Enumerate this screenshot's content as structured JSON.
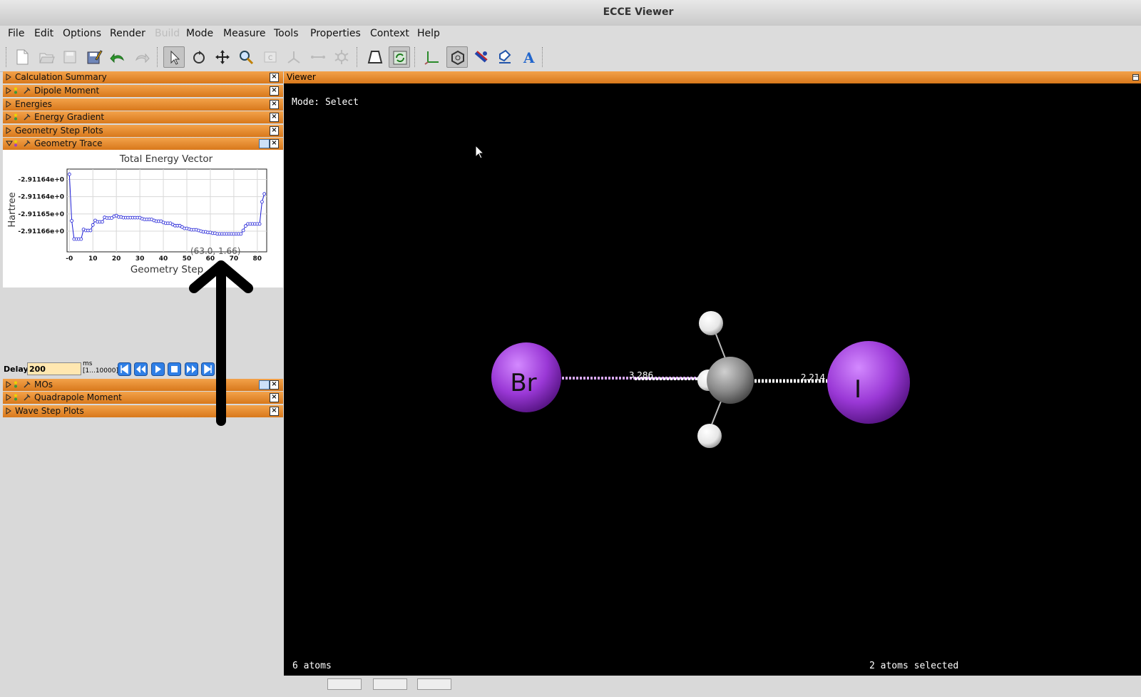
{
  "window": {
    "title": "ECCE Viewer"
  },
  "menu": [
    {
      "label": "File"
    },
    {
      "label": "Edit"
    },
    {
      "label": "Options"
    },
    {
      "label": "Render"
    },
    {
      "label": "Build",
      "disabled": true
    },
    {
      "label": "Mode"
    },
    {
      "label": "Measure"
    },
    {
      "label": "Tools"
    },
    {
      "label": "Properties"
    },
    {
      "label": "Context"
    },
    {
      "label": "Help"
    }
  ],
  "toolbar": {
    "icons": [
      "new-file-icon",
      "open-icon",
      "save-icon",
      "save-as-icon",
      "undo-icon",
      "redo-icon",
      "select-icon",
      "rotate-icon",
      "translate-icon",
      "zoom-icon",
      "center-icon",
      "angle-icon",
      "bond-icon",
      "atom-icon",
      "perspective-icon",
      "sync-icon",
      "axes-icon",
      "hexagon-icon",
      "color-icon",
      "label-style-icon",
      "text-label-icon"
    ]
  },
  "panels": [
    {
      "label": "Calculation Summary"
    },
    {
      "label": "Dipole Moment"
    },
    {
      "label": "Energies"
    },
    {
      "label": "Energy Gradient"
    },
    {
      "label": "Geometry Step Plots"
    },
    {
      "label": "Geometry Trace"
    },
    {
      "label": "MOs"
    },
    {
      "label": "Quadrapole Moment"
    },
    {
      "label": "Wave Step Plots"
    }
  ],
  "chart_data": {
    "type": "line",
    "title": "Total Energy Vector",
    "xlabel": "Geometry Step",
    "ylabel": "Hartree",
    "xlim": [
      -1,
      84
    ],
    "ylim": [
      -2.911665,
      -2.911641
    ],
    "x_ticks": [
      "-0",
      "10",
      "20",
      "30",
      "40",
      "50",
      "60",
      "70",
      "80"
    ],
    "y_ticks": [
      "-2.91164e+0",
      "-2.91164e+0",
      "-2.91165e+0",
      "-2.91166e+0"
    ],
    "y_tick_values": [
      -2.911644,
      -2.911649,
      -2.911654,
      -2.911659
    ],
    "overlay_text": "(63.0, 1.66)",
    "series": [
      {
        "values": [
          [
            0,
            -2.9116425
          ],
          [
            1,
            -2.911656
          ],
          [
            2,
            -2.9116613
          ],
          [
            3,
            -2.9116613
          ],
          [
            4,
            -2.9116613
          ],
          [
            5,
            -2.9116613
          ],
          [
            6,
            -2.9116585
          ],
          [
            7,
            -2.9116588
          ],
          [
            8,
            -2.9116588
          ],
          [
            9,
            -2.9116588
          ],
          [
            10,
            -2.9116572
          ],
          [
            11,
            -2.9116559
          ],
          [
            12,
            -2.9116563
          ],
          [
            13,
            -2.9116563
          ],
          [
            14,
            -2.9116563
          ],
          [
            15,
            -2.911655
          ],
          [
            16,
            -2.9116552
          ],
          [
            17,
            -2.9116552
          ],
          [
            18,
            -2.9116552
          ],
          [
            19,
            -2.9116547
          ],
          [
            20,
            -2.9116545
          ],
          [
            21,
            -2.9116549
          ],
          [
            22,
            -2.9116549
          ],
          [
            23,
            -2.9116551
          ],
          [
            24,
            -2.9116551
          ],
          [
            25,
            -2.9116551
          ],
          [
            26,
            -2.9116551
          ],
          [
            27,
            -2.9116551
          ],
          [
            28,
            -2.9116551
          ],
          [
            29,
            -2.9116551
          ],
          [
            30,
            -2.9116551
          ],
          [
            31,
            -2.9116554
          ],
          [
            32,
            -2.9116556
          ],
          [
            33,
            -2.9116556
          ],
          [
            34,
            -2.9116556
          ],
          [
            35,
            -2.9116556
          ],
          [
            36,
            -2.9116559
          ],
          [
            37,
            -2.9116561
          ],
          [
            38,
            -2.9116561
          ],
          [
            39,
            -2.9116561
          ],
          [
            40,
            -2.9116565
          ],
          [
            41,
            -2.9116567
          ],
          [
            42,
            -2.9116567
          ],
          [
            43,
            -2.9116567
          ],
          [
            44,
            -2.9116571
          ],
          [
            45,
            -2.9116574
          ],
          [
            46,
            -2.9116574
          ],
          [
            47,
            -2.9116574
          ],
          [
            48,
            -2.9116578
          ],
          [
            49,
            -2.9116582
          ],
          [
            50,
            -2.9116582
          ],
          [
            51,
            -2.9116584
          ],
          [
            52,
            -2.9116586
          ],
          [
            53,
            -2.9116586
          ],
          [
            54,
            -2.9116586
          ],
          [
            55,
            -2.9116588
          ],
          [
            56,
            -2.911659
          ],
          [
            57,
            -2.9116592
          ],
          [
            58,
            -2.9116592
          ],
          [
            59,
            -2.9116594
          ],
          [
            60,
            -2.9116594
          ],
          [
            61,
            -2.9116596
          ],
          [
            62,
            -2.9116596
          ],
          [
            63,
            -2.9116598
          ],
          [
            64,
            -2.9116598
          ],
          [
            65,
            -2.9116598
          ],
          [
            66,
            -2.9116598
          ],
          [
            67,
            -2.9116598
          ],
          [
            68,
            -2.9116598
          ],
          [
            69,
            -2.9116598
          ],
          [
            70,
            -2.9116598
          ],
          [
            71,
            -2.9116598
          ],
          [
            72,
            -2.9116598
          ],
          [
            73,
            -2.9116598
          ],
          [
            74,
            -2.9116588
          ],
          [
            75,
            -2.9116575
          ],
          [
            76,
            -2.9116569
          ],
          [
            77,
            -2.9116569
          ],
          [
            78,
            -2.9116569
          ],
          [
            79,
            -2.9116569
          ],
          [
            80,
            -2.9116569
          ],
          [
            81,
            -2.9116569
          ],
          [
            82,
            -2.9116505
          ],
          [
            83,
            -2.9116482
          ]
        ]
      }
    ]
  },
  "trace": {
    "delay_label": "Delay:",
    "delay_value": "200",
    "units_label": "ms",
    "range_label": "[1...10000]",
    "buttons": [
      "first-frame-icon",
      "step-back-icon",
      "play-icon",
      "stop-icon",
      "step-forward-icon",
      "last-frame-icon"
    ]
  },
  "viewer": {
    "header": "Viewer",
    "mode_text": "Mode: Select",
    "atom_count": "6 atoms",
    "selection_text": "2 atoms selected",
    "atoms": [
      {
        "element": "Br",
        "label": "Br"
      },
      {
        "element": "I",
        "label": "I"
      }
    ],
    "distance_labels": [
      "3.286",
      "2.214"
    ]
  }
}
